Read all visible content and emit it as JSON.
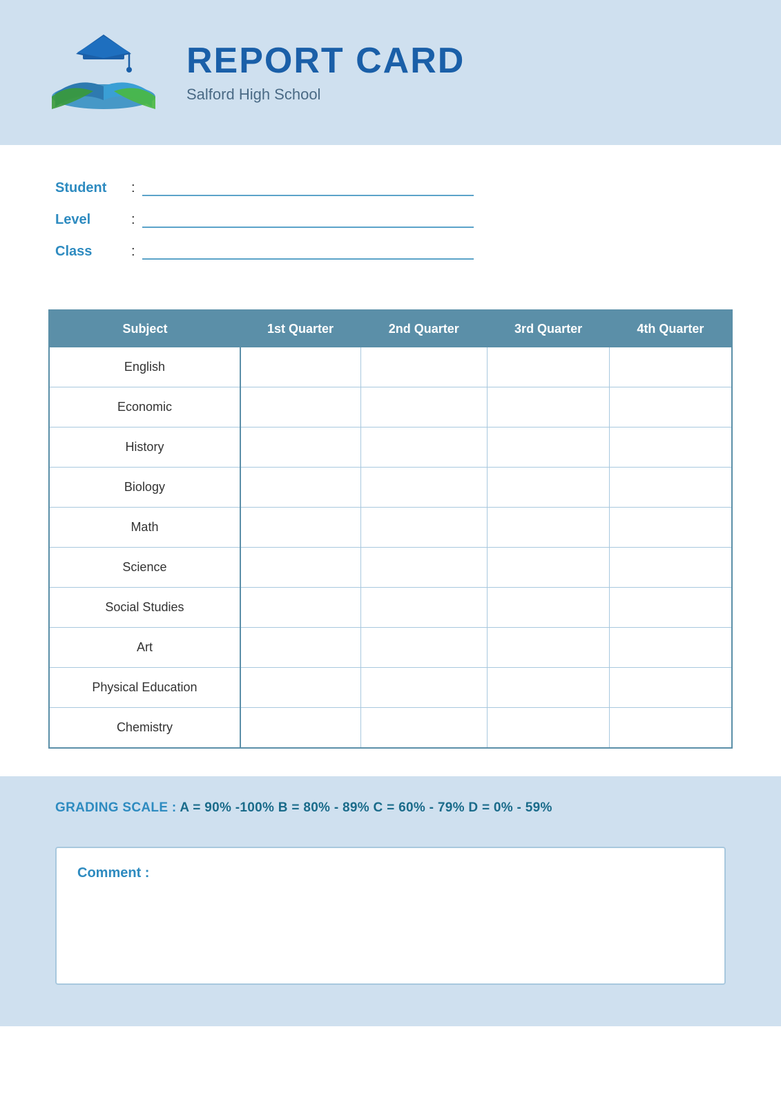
{
  "header": {
    "title": "REPORT CARD",
    "school": "Salford High School"
  },
  "student_info": {
    "student_label": "Student",
    "level_label": "Level",
    "class_label": "Class",
    "colon": ":"
  },
  "table": {
    "headers": [
      "Subject",
      "1st Quarter",
      "2nd Quarter",
      "3rd Quarter",
      "4th Quarter"
    ],
    "subjects": [
      "English",
      "Economic",
      "History",
      "Biology",
      "Math",
      "Science",
      "Social Studies",
      "Art",
      "Physical Education",
      "Chemistry"
    ]
  },
  "grading_scale": {
    "label": "GRADING SCALE :",
    "text": "    A = 90% -100%  B = 80% - 89%  C = 60% - 79%  D = 0% - 59%"
  },
  "comment": {
    "label": "Comment :"
  }
}
